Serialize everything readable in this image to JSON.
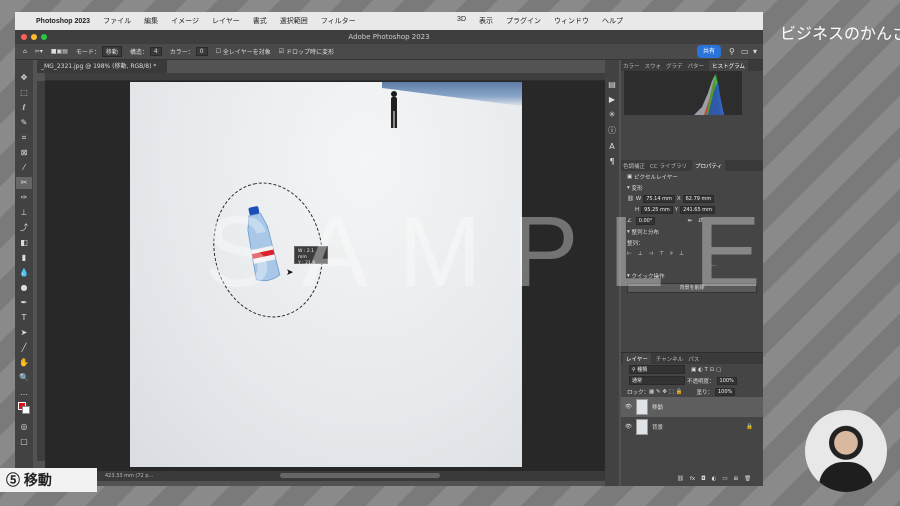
{
  "menubar": {
    "app": "Photoshop 2023",
    "items": [
      "ファイル",
      "編集",
      "イメージ",
      "レイヤー",
      "書式",
      "選択範囲",
      "フィルター"
    ],
    "right_items": [
      "3D",
      "表示",
      "プラグイン",
      "ウィンドウ",
      "ヘルプ"
    ]
  },
  "window_title": "Adobe Photoshop 2023",
  "options": {
    "mode_label": "モード：",
    "mode_value": "移動",
    "structure_label": "構造：",
    "structure_value": "4",
    "color_label": "カラー：",
    "color_value": "0",
    "sample_all": "全レイヤーを対象",
    "transform_on_drop": "ドロップ時に変形",
    "share": "共有"
  },
  "document": {
    "tab": "_MG_2321.jpg @ 198% (移動, RGB/8) *",
    "status": "423.33 mm (72 p...",
    "tooltip_w": "W : 2.1 mm",
    "tooltip_h": "Y : 21.9 mm",
    "watermark": "SAMPLE"
  },
  "panels": {
    "top_tabs": [
      "カラー",
      "スウォ",
      "グラデ",
      "パター",
      "ヒストグラム"
    ],
    "prop_tabs": [
      "色調補正",
      "CC ライブラリ",
      "プロパティ"
    ],
    "pixel_layer": "ピクセルレイヤー",
    "transform_header": "変形",
    "w_label": "W",
    "w_value": "75.14 mm",
    "x_label": "X",
    "x_value": "62.79 mm",
    "h_label": "H",
    "h_value": "95.25 mm",
    "y_label": "Y",
    "y_value": "241.65 mm",
    "angle_value": "0.00°",
    "align_header": "整列と分布",
    "align_label": "整列：",
    "quick_header": "クイック操作",
    "remove_bg": "背景を削除",
    "layer_tabs": [
      "レイヤー",
      "チャンネル",
      "パス"
    ],
    "kind": "種類",
    "blend": "通常",
    "opacity_label": "不透明度：",
    "opacity_value": "100%",
    "lock_label": "ロック：",
    "fill_label": "塗り：",
    "fill_value": "100%",
    "layers": [
      "移動",
      "背景"
    ]
  },
  "overlay": {
    "caption": "⑤ 移動",
    "logo": "ビジネスのかんさつ"
  }
}
